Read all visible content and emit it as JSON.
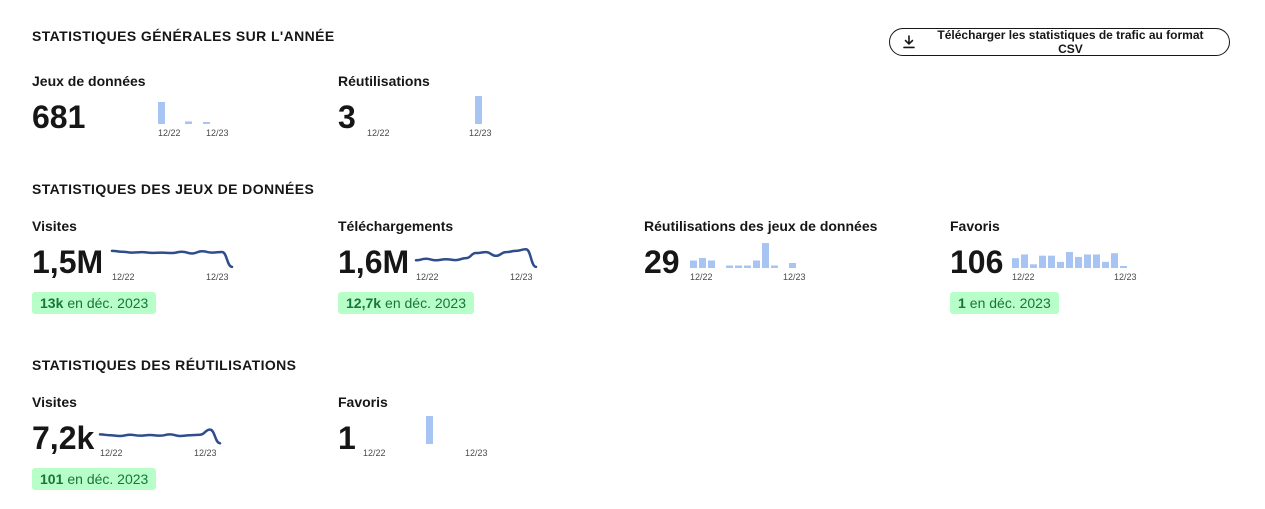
{
  "general": {
    "title": "STATISTIQUES GÉNÉRALES SUR L'ANNÉE",
    "download_label": "Télécharger les statistiques de trafic au format CSV",
    "datasets": {
      "label": "Jeux de données",
      "value": "681",
      "tick_start": "12/22",
      "tick_end": "12/23",
      "bars": [
        17,
        0,
        0,
        2,
        0,
        1,
        0
      ]
    },
    "reuses": {
      "label": "Réutilisations",
      "value": "3",
      "tick_start": "12/22",
      "tick_end": "12/23",
      "bars": [
        0,
        0,
        0,
        0,
        0,
        0,
        0,
        0,
        0,
        0,
        0,
        0,
        3
      ]
    }
  },
  "datasets_stats": {
    "title": "STATISTIQUES DES JEUX DE DONNÉES",
    "visits": {
      "label": "Visites",
      "value": "1,5M",
      "tick_start": "12/22",
      "tick_end": "12/23",
      "badge_value": "13k",
      "badge_text": "en déc. 2023",
      "line": [
        0.78,
        0.74,
        0.7,
        0.72,
        0.69,
        0.7,
        0.68,
        0.74,
        0.66,
        0.76,
        0.7,
        0.73,
        0.05
      ]
    },
    "downloads": {
      "label": "Téléchargements",
      "value": "1,6M",
      "tick_start": "12/22",
      "tick_end": "12/23",
      "badge_value": "12,7k",
      "badge_text": "en déc. 2023",
      "line": [
        0.35,
        0.42,
        0.35,
        0.4,
        0.36,
        0.45,
        0.68,
        0.72,
        0.55,
        0.72,
        0.78,
        0.85,
        0.05
      ]
    },
    "reuses": {
      "label": "Réutilisations des jeux de données",
      "value": "29",
      "tick_start": "12/22",
      "tick_end": "12/23",
      "bars": [
        3,
        4,
        3,
        0,
        1,
        1,
        1,
        3,
        10,
        1,
        0,
        2
      ]
    },
    "favorites": {
      "label": "Favoris",
      "value": "106",
      "tick_start": "12/22",
      "tick_end": "12/23",
      "badge_value": "1",
      "badge_text": "en déc. 2023",
      "bars": [
        8,
        11,
        3,
        10,
        10,
        5,
        13,
        9,
        11,
        11,
        5,
        12,
        1
      ]
    }
  },
  "reuses_stats": {
    "title": "STATISTIQUES DES RÉUTILISATIONS",
    "visits": {
      "label": "Visites",
      "value": "7,2k",
      "tick_start": "12/22",
      "tick_end": "12/23",
      "badge_value": "101",
      "badge_text": "en déc. 2023",
      "line": [
        0.6,
        0.55,
        0.5,
        0.58,
        0.52,
        0.56,
        0.52,
        0.6,
        0.5,
        0.55,
        0.58,
        0.9,
        0.05
      ]
    },
    "favorites": {
      "label": "Favoris",
      "value": "1",
      "tick_start": "12/22",
      "tick_end": "12/23",
      "bars": [
        0,
        0,
        0,
        0,
        0,
        0,
        0,
        1,
        0,
        0,
        0,
        0,
        0
      ]
    }
  },
  "colors": {
    "bar": "#a7c4f2",
    "line": "#2f4d8c",
    "badge_bg": "#b8fec9",
    "badge_text": "#18753c"
  }
}
